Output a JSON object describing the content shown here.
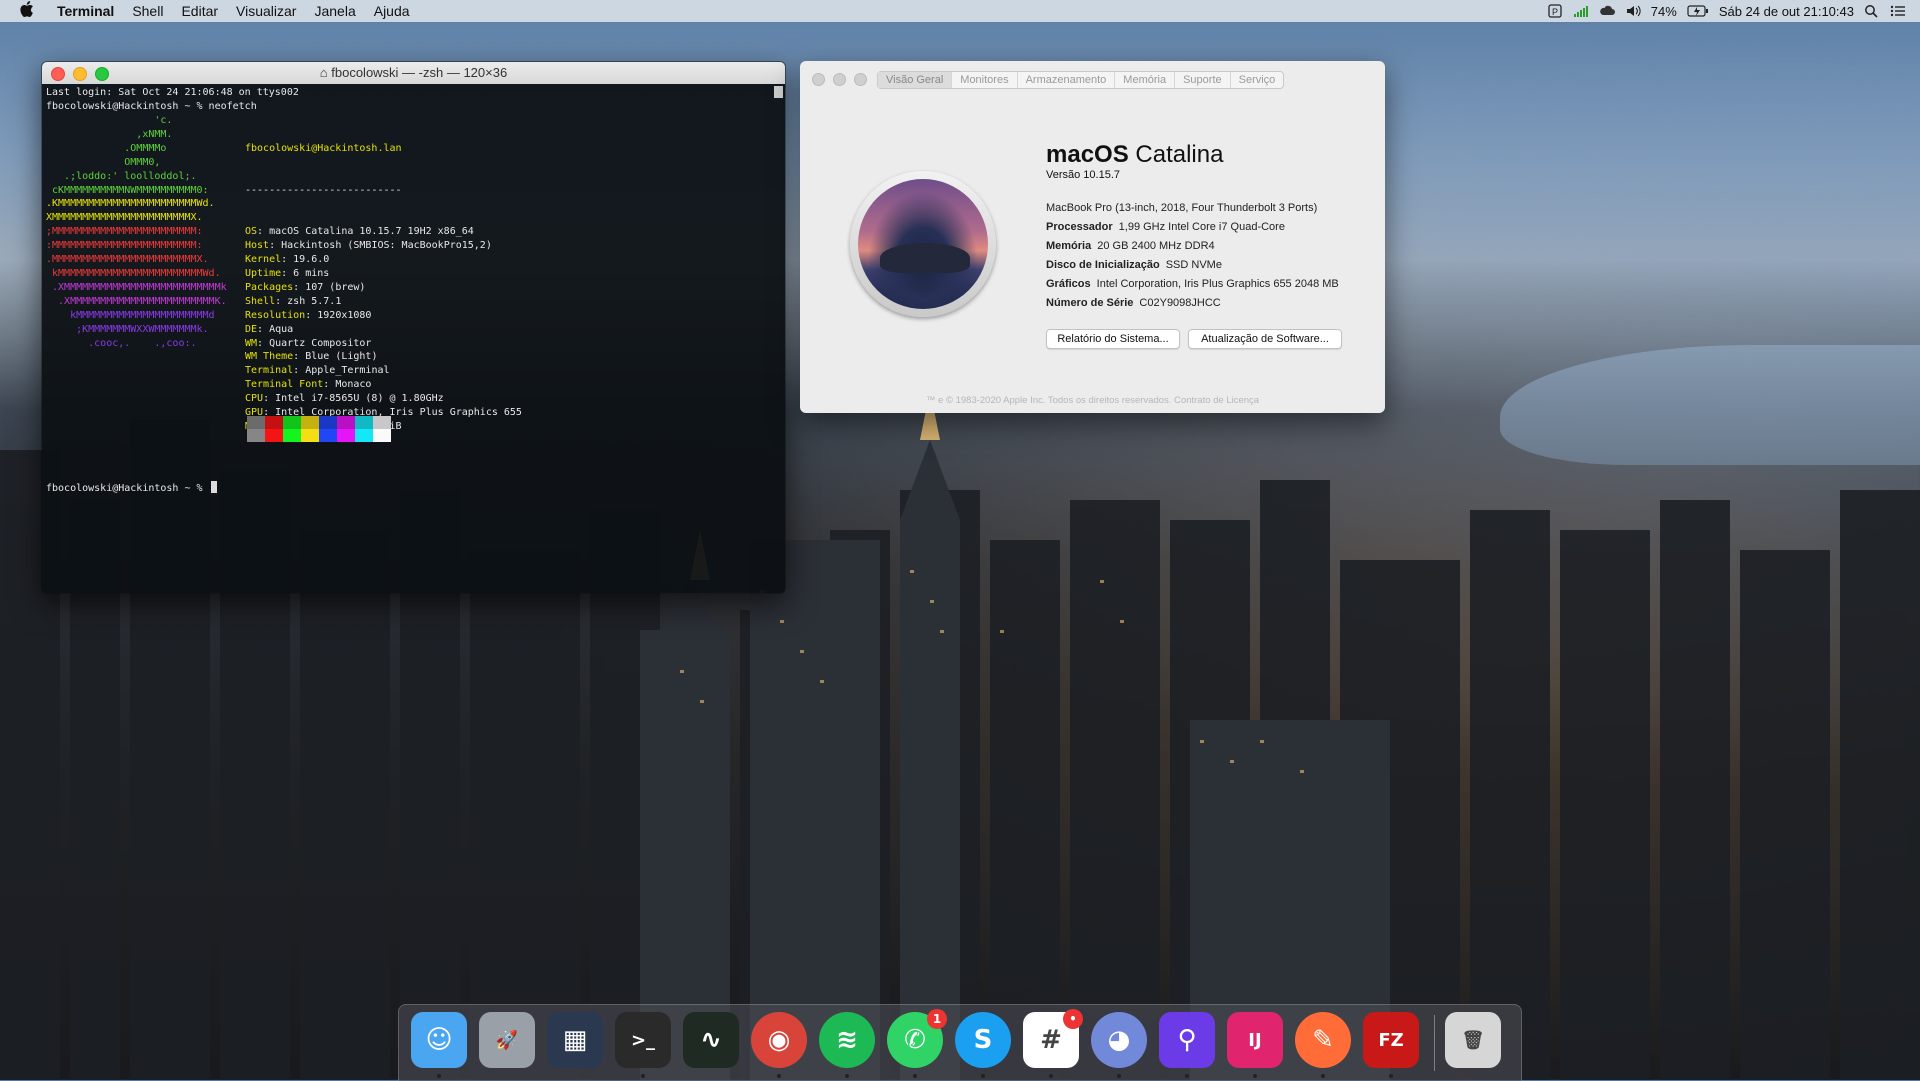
{
  "menubar": {
    "app": "Terminal",
    "items": [
      "Shell",
      "Editar",
      "Visualizar",
      "Janela",
      "Ajuda"
    ],
    "battery": "74%",
    "clock": "Sáb 24 de out  21:10:43"
  },
  "terminal": {
    "title": "fbocolowski — -zsh — 120×36",
    "line1": "Last login: Sat Oct 24 21:06:48 on ttys002",
    "line2": "fbocolowski@Hackintosh ~ % neofetch",
    "userhost": "fbocolowski@Hackintosh.lan",
    "rule": "--------------------------",
    "info": [
      {
        "k": "OS",
        "v": "macOS Catalina 10.15.7 19H2 x86_64"
      },
      {
        "k": "Host",
        "v": "Hackintosh (SMBIOS: MacBookPro15,2)"
      },
      {
        "k": "Kernel",
        "v": "19.6.0"
      },
      {
        "k": "Uptime",
        "v": "6 mins"
      },
      {
        "k": "Packages",
        "v": "107 (brew)"
      },
      {
        "k": "Shell",
        "v": "zsh 5.7.1"
      },
      {
        "k": "Resolution",
        "v": "1920x1080"
      },
      {
        "k": "DE",
        "v": "Aqua"
      },
      {
        "k": "WM",
        "v": "Quartz Compositor"
      },
      {
        "k": "WM Theme",
        "v": "Blue (Light)"
      },
      {
        "k": "Terminal",
        "v": "Apple_Terminal"
      },
      {
        "k": "Terminal Font",
        "v": "Monaco"
      },
      {
        "k": "CPU",
        "v": "Intel i7-8565U (8) @ 1.80GHz"
      },
      {
        "k": "GPU",
        "v": "Intel Corporation, Iris Plus Graphics 655"
      },
      {
        "k": "Memory",
        "v": "7090MiB / 20480MiB"
      }
    ],
    "logo": [
      {
        "t": "                  'c.",
        "c": "#5fd13a"
      },
      {
        "t": "               ,xNMM.",
        "c": "#5fd13a"
      },
      {
        "t": "             .OMMMMo",
        "c": "#5fd13a"
      },
      {
        "t": "             OMMM0,",
        "c": "#5fd13a"
      },
      {
        "t": "   .;loddo:' loolloddol;.",
        "c": "#5fd13a"
      },
      {
        "t": " cKMMMMMMMMMMNWMMMMMMMMMM0:",
        "c": "#5fd13a"
      },
      {
        "t": ".KMMMMMMMMMMMMMMMMMMMMMMMWd.",
        "c": "#e8e20c"
      },
      {
        "t": "XMMMMMMMMMMMMMMMMMMMMMMMX.",
        "c": "#e8e20c"
      },
      {
        "t": ";MMMMMMMMMMMMMMMMMMMMMMMM:",
        "c": "#ef3a3a"
      },
      {
        "t": ":MMMMMMMMMMMMMMMMMMMMMMMM:",
        "c": "#ef3a3a"
      },
      {
        "t": ".MMMMMMMMMMMMMMMMMMMMMMMMX.",
        "c": "#ef3a3a"
      },
      {
        "t": " kMMMMMMMMMMMMMMMMMMMMMMMMWd.",
        "c": "#ef3a3a"
      },
      {
        "t": " .XMMMMMMMMMMMMMMMMMMMMMMMMMMk",
        "c": "#c23ad6"
      },
      {
        "t": "  .XMMMMMMMMMMMMMMMMMMMMMMMMK.",
        "c": "#c23ad6"
      },
      {
        "t": "    kMMMMMMMMMMMMMMMMMMMMMMd",
        "c": "#8a3ae8"
      },
      {
        "t": "     ;KMMMMMMMWXXWMMMMMMMk.",
        "c": "#8a3ae8"
      },
      {
        "t": "       .cooc,.    .,coo:.",
        "c": "#8a3ae8"
      }
    ],
    "swatches": [
      "#6b6b6b",
      "#c41010",
      "#10c41a",
      "#c4b210",
      "#1a38c4",
      "#b910c4",
      "#10b9c4",
      "#c8c8c8"
    ],
    "prompt": "fbocolowski@Hackintosh ~ % "
  },
  "about": {
    "tabs": [
      "Visão Geral",
      "Monitores",
      "Armazenamento",
      "Memória",
      "Suporte",
      "Serviço"
    ],
    "os_bold": "macOS",
    "os_name": "Catalina",
    "version": "Versão 10.15.7",
    "model": "MacBook Pro (13-inch, 2018, Four Thunderbolt 3 Ports)",
    "specs": [
      {
        "k": "Processador",
        "v": "1,99 GHz Intel Core i7 Quad-Core"
      },
      {
        "k": "Memória",
        "v": "20 GB 2400 MHz DDR4"
      },
      {
        "k": "Disco de Inicialização",
        "v": "SSD NVMe"
      },
      {
        "k": "Gráficos",
        "v": "Intel Corporation, Iris Plus Graphics 655 2048 MB"
      },
      {
        "k": "Número de Série",
        "v": "C02Y9098JHCC"
      }
    ],
    "btn_report": "Relatório do Sistema...",
    "btn_update": "Atualização de Software...",
    "footer": "™ e © 1983-2020 Apple Inc. Todos os direitos reservados. Contrato de Licença"
  },
  "dock": {
    "apps": [
      {
        "name": "finder",
        "glyph": "☺",
        "bg": "#4aa6f0",
        "running": true
      },
      {
        "name": "launchpad",
        "glyph": "🚀",
        "bg": "#9aa0a8",
        "running": false
      },
      {
        "name": "sourcetree",
        "glyph": "▦",
        "bg": "#2b3950",
        "running": false
      },
      {
        "name": "terminal",
        "glyph": ">_",
        "bg": "#2a2a2a",
        "running": true
      },
      {
        "name": "activity-monitor",
        "glyph": "∿",
        "bg": "#1f2a22",
        "running": false
      },
      {
        "name": "chrome",
        "glyph": "◉",
        "bg": "#d8443a",
        "running": true
      },
      {
        "name": "spotify",
        "glyph": "≋",
        "bg": "#1db954",
        "running": true
      },
      {
        "name": "whatsapp",
        "glyph": "✆",
        "bg": "#2fd366",
        "running": true,
        "badge": "1"
      },
      {
        "name": "skype",
        "glyph": "S",
        "bg": "#1b9ff0",
        "running": true
      },
      {
        "name": "slack",
        "glyph": "#",
        "bg": "#ffffff",
        "running": true,
        "badge": "•"
      },
      {
        "name": "discord",
        "glyph": "◕",
        "bg": "#7289da",
        "running": true
      },
      {
        "name": "keybase",
        "glyph": "⚲",
        "bg": "#6b3be8",
        "running": true
      },
      {
        "name": "intellij",
        "glyph": "IJ",
        "bg": "#e0246e",
        "running": true
      },
      {
        "name": "postman",
        "glyph": "✎",
        "bg": "#ff6c37",
        "running": true
      },
      {
        "name": "filezilla",
        "glyph": "FZ",
        "bg": "#c81818",
        "running": true
      },
      {
        "name": "trash",
        "glyph": "🗑",
        "bg": "#d6d6d6",
        "running": false
      }
    ]
  }
}
